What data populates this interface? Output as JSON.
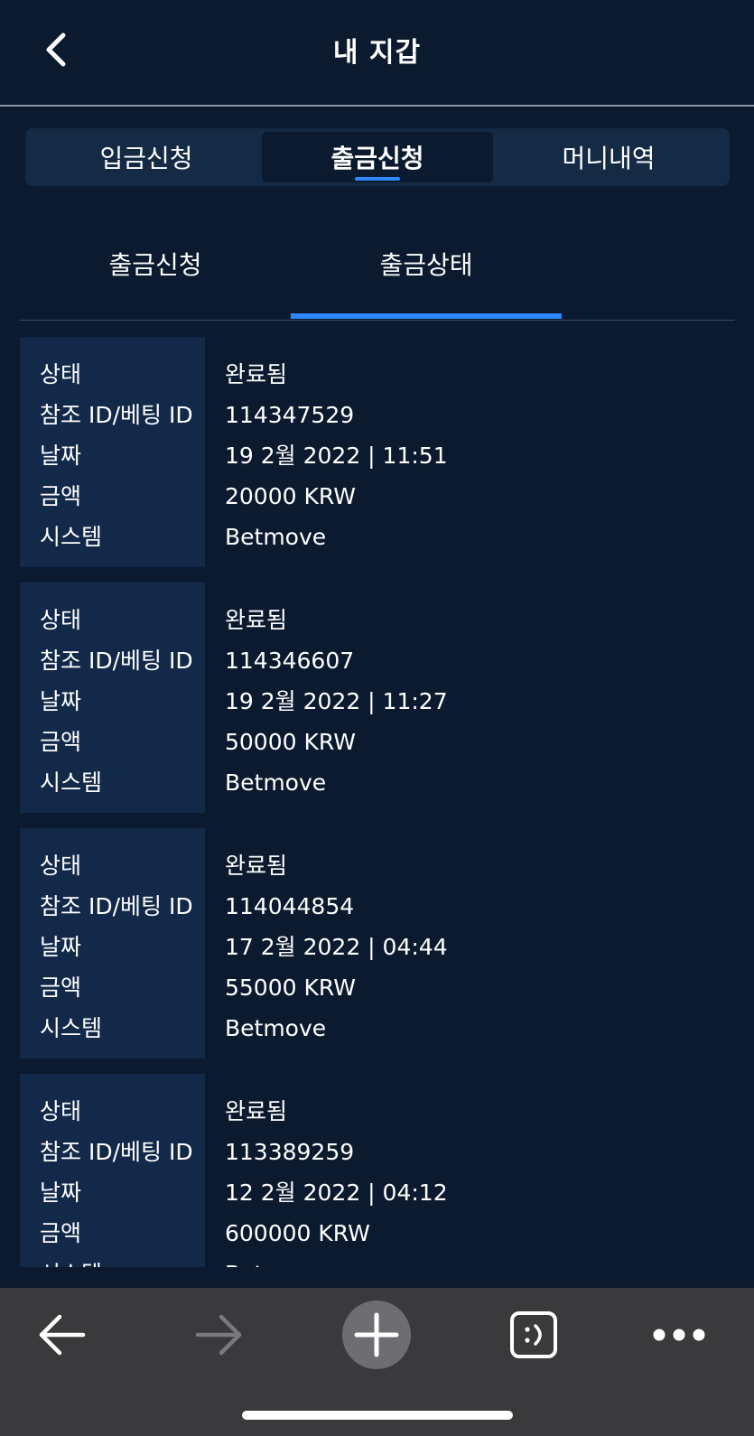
{
  "header": {
    "title": "내 지갑"
  },
  "segmented_tabs": [
    {
      "label": "입금신청",
      "active": false
    },
    {
      "label": "출금신청",
      "active": true
    },
    {
      "label": "머니내역",
      "active": false
    }
  ],
  "sub_tabs": [
    {
      "label": "출금신청",
      "active": false
    },
    {
      "label": "출금상태",
      "active": true
    }
  ],
  "field_labels": {
    "status": "상태",
    "ref_id": "참조 ID/베팅 ID",
    "date": "날짜",
    "amount": "금액",
    "system": "시스템"
  },
  "records": [
    {
      "status": "완료됨",
      "ref_id": "114347529",
      "date": "19 2월 2022 | 11:51",
      "amount": "20000 KRW",
      "system": "Betmove"
    },
    {
      "status": "완료됨",
      "ref_id": "114346607",
      "date": "19 2월 2022 | 11:27",
      "amount": "50000 KRW",
      "system": "Betmove"
    },
    {
      "status": "완료됨",
      "ref_id": "114044854",
      "date": "17 2월 2022 | 04:44",
      "amount": "55000 KRW",
      "system": "Betmove"
    },
    {
      "status": "완료됨",
      "ref_id": "113389259",
      "date": "12 2월 2022 | 04:12",
      "amount": "600000 KRW",
      "system": "Betmove"
    }
  ],
  "toolbar": {
    "icons": [
      "back-arrow-icon",
      "forward-arrow-icon",
      "plus-icon",
      "tabs-icon",
      "more-icon"
    ]
  },
  "colors": {
    "background": "#0b1a2e",
    "accent": "#2f86ff",
    "label_panel": "#13294a",
    "toolbar": "#3a3a3c"
  }
}
